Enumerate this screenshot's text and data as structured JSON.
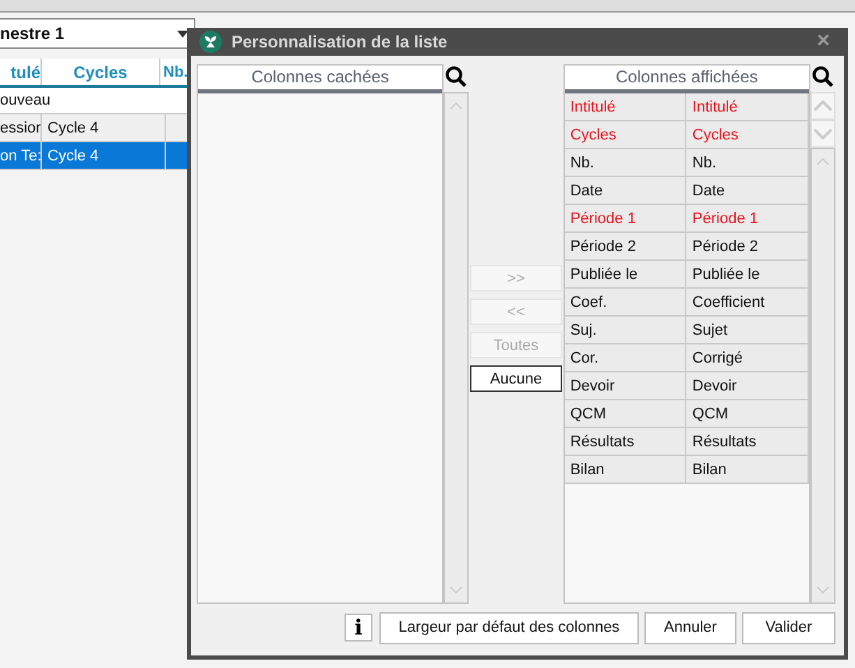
{
  "background": {
    "period_select": "nestre 1",
    "table": {
      "columns": [
        "tulé",
        "Cycles",
        "Nb."
      ],
      "group": "ouveau",
      "rows": [
        {
          "cells": [
            "essior",
            "Cycle 4"
          ],
          "selected": false
        },
        {
          "cells": [
            "on Te:",
            "Cycle 4"
          ],
          "selected": true
        }
      ]
    }
  },
  "dialog": {
    "title": "Personnalisation de la liste",
    "close": "×",
    "hidden_list": {
      "heading": "Colonnes cachées"
    },
    "move_buttons": [
      {
        "label": ">>",
        "disabled": true
      },
      {
        "label": "<<",
        "disabled": true
      },
      {
        "label": "Toutes",
        "disabled": true
      },
      {
        "label": "Aucune",
        "disabled": false
      }
    ],
    "shown_list": {
      "heading": "Colonnes affichées",
      "rows": [
        {
          "short": "Intitulé",
          "long": "Intitulé",
          "required": true
        },
        {
          "short": "Cycles",
          "long": "Cycles",
          "required": true
        },
        {
          "short": "Nb.",
          "long": "Nb.",
          "required": false
        },
        {
          "short": "Date",
          "long": "Date",
          "required": false
        },
        {
          "short": "Période 1",
          "long": "Période 1",
          "required": true
        },
        {
          "short": "Période 2",
          "long": "Période 2",
          "required": false
        },
        {
          "short": "Publiée le",
          "long": "Publiée le",
          "required": false
        },
        {
          "short": "Coef.",
          "long": "Coefficient",
          "required": false
        },
        {
          "short": "Suj.",
          "long": "Sujet",
          "required": false
        },
        {
          "short": "Cor.",
          "long": "Corrigé",
          "required": false
        },
        {
          "short": "Devoir",
          "long": "Devoir",
          "required": false
        },
        {
          "short": "QCM",
          "long": "QCM",
          "required": false
        },
        {
          "short": "Résultats",
          "long": "Résultats",
          "required": false
        },
        {
          "short": "Bilan",
          "long": "Bilan",
          "required": false
        }
      ]
    },
    "info": "i",
    "buttons": [
      "Largeur par défaut des colonnes",
      "Annuler",
      "Valider"
    ]
  }
}
